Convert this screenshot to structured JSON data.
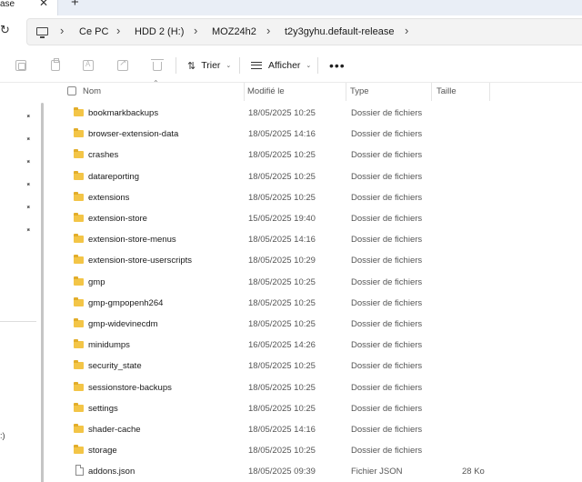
{
  "tab": {
    "title": "ase",
    "close_glyph": "✕",
    "new_glyph": "+"
  },
  "address": {
    "refresh_glyph": "↻",
    "separator": "›",
    "crumbs": [
      "Ce PC",
      "HDD 2 (H:)",
      "MOZ24h2",
      "t2y3gyhu.default-release"
    ]
  },
  "toolbar": {
    "sort_label": "Trier",
    "view_label": "Afficher",
    "more_glyph": "•••",
    "chevron": "⌄",
    "icons": [
      "copy-icon",
      "paste-icon",
      "rename-icon",
      "share-icon",
      "delete-icon"
    ]
  },
  "nav": {
    "pin_glyph": "✦",
    "partial_text": ":)"
  },
  "columns": {
    "name": "Nom",
    "modified": "Modifié le",
    "type": "Type",
    "size": "Taille",
    "sort_caret": "⌃"
  },
  "files": [
    {
      "name": "bookmarkbackups",
      "modified": "18/05/2025 10:25",
      "type": "Dossier de fichiers",
      "size": "",
      "kind": "folder"
    },
    {
      "name": "browser-extension-data",
      "modified": "18/05/2025 14:16",
      "type": "Dossier de fichiers",
      "size": "",
      "kind": "folder"
    },
    {
      "name": "crashes",
      "modified": "18/05/2025 10:25",
      "type": "Dossier de fichiers",
      "size": "",
      "kind": "folder"
    },
    {
      "name": "datareporting",
      "modified": "18/05/2025 10:25",
      "type": "Dossier de fichiers",
      "size": "",
      "kind": "folder"
    },
    {
      "name": "extensions",
      "modified": "18/05/2025 10:25",
      "type": "Dossier de fichiers",
      "size": "",
      "kind": "folder"
    },
    {
      "name": "extension-store",
      "modified": "15/05/2025 19:40",
      "type": "Dossier de fichiers",
      "size": "",
      "kind": "folder"
    },
    {
      "name": "extension-store-menus",
      "modified": "18/05/2025 14:16",
      "type": "Dossier de fichiers",
      "size": "",
      "kind": "folder"
    },
    {
      "name": "extension-store-userscripts",
      "modified": "18/05/2025 10:29",
      "type": "Dossier de fichiers",
      "size": "",
      "kind": "folder"
    },
    {
      "name": "gmp",
      "modified": "18/05/2025 10:25",
      "type": "Dossier de fichiers",
      "size": "",
      "kind": "folder"
    },
    {
      "name": "gmp-gmpopenh264",
      "modified": "18/05/2025 10:25",
      "type": "Dossier de fichiers",
      "size": "",
      "kind": "folder"
    },
    {
      "name": "gmp-widevinecdm",
      "modified": "18/05/2025 10:25",
      "type": "Dossier de fichiers",
      "size": "",
      "kind": "folder"
    },
    {
      "name": "minidumps",
      "modified": "16/05/2025 14:26",
      "type": "Dossier de fichiers",
      "size": "",
      "kind": "folder"
    },
    {
      "name": "security_state",
      "modified": "18/05/2025 10:25",
      "type": "Dossier de fichiers",
      "size": "",
      "kind": "folder"
    },
    {
      "name": "sessionstore-backups",
      "modified": "18/05/2025 10:25",
      "type": "Dossier de fichiers",
      "size": "",
      "kind": "folder"
    },
    {
      "name": "settings",
      "modified": "18/05/2025 10:25",
      "type": "Dossier de fichiers",
      "size": "",
      "kind": "folder"
    },
    {
      "name": "shader-cache",
      "modified": "18/05/2025 14:16",
      "type": "Dossier de fichiers",
      "size": "",
      "kind": "folder"
    },
    {
      "name": "storage",
      "modified": "18/05/2025 10:25",
      "type": "Dossier de fichiers",
      "size": "",
      "kind": "folder"
    },
    {
      "name": "addons.json",
      "modified": "18/05/2025 09:39",
      "type": "Fichier JSON",
      "size": "28 Ko",
      "kind": "file"
    }
  ],
  "colors": {
    "folder": "#f3c547",
    "folder_tab": "#e2ad2a",
    "address_bg": "#f3f3f3",
    "tabstrip_bg": "#e9eef6"
  }
}
